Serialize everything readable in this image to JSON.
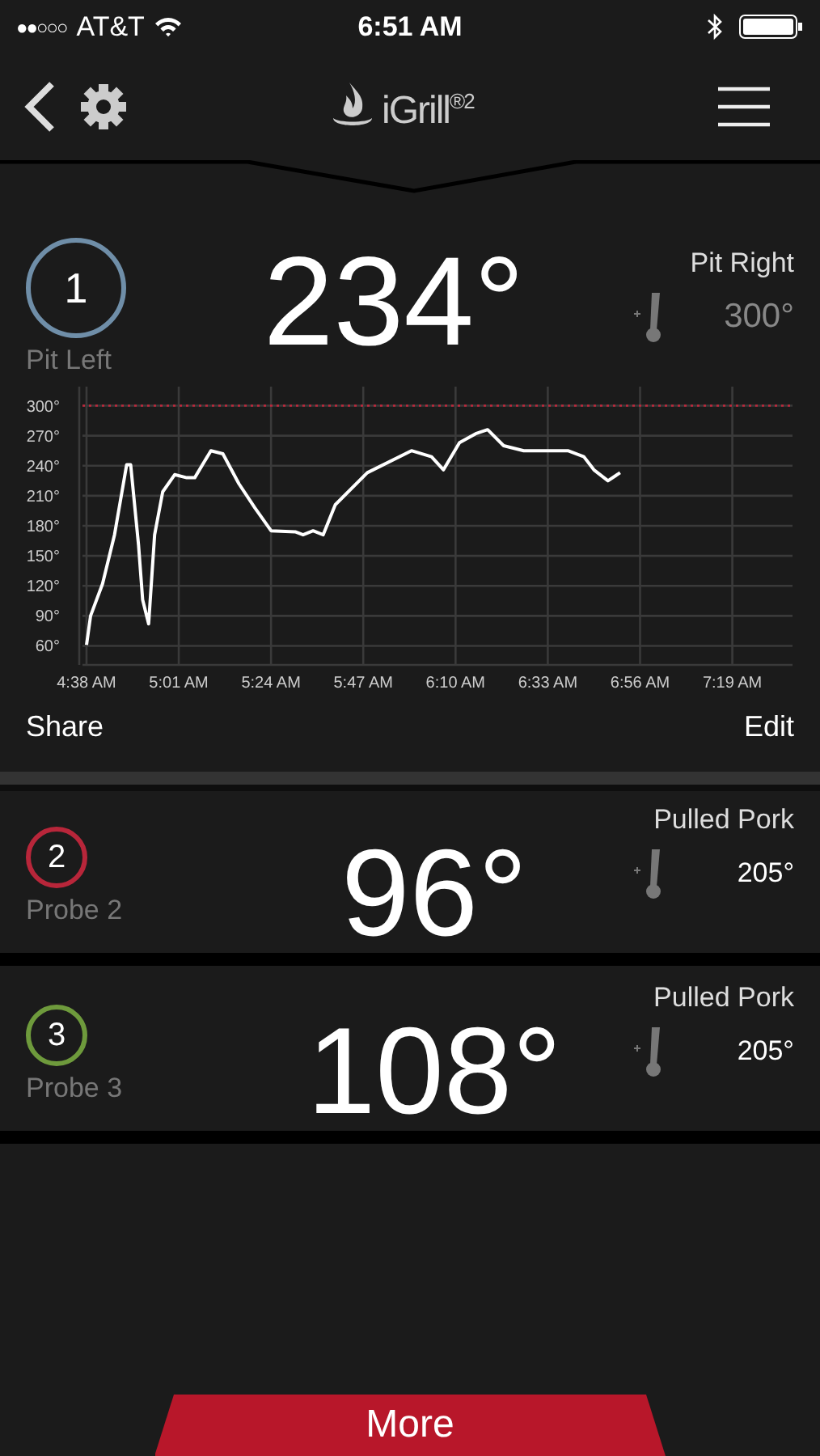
{
  "status_bar": {
    "signal": "●●○○○",
    "carrier": "AT&T",
    "time": "6:51 AM"
  },
  "header": {
    "logo": "iGrill$^{®2}$"
  },
  "main_probe": {
    "number": "1",
    "name": "Pit Left",
    "temp": "234°",
    "color": "#6f8ea8",
    "target_label": "Pit Right",
    "target": "300°",
    "chart_data": {
      "type": "line",
      "x": [
        278,
        279,
        282,
        285,
        288,
        289,
        291,
        292,
        293.5,
        295,
        297,
        300,
        303,
        305,
        309,
        312,
        316,
        320,
        324,
        330,
        332,
        334.5,
        337,
        340,
        348,
        359,
        364,
        367,
        371,
        375,
        378,
        382,
        387,
        398,
        402,
        404.5,
        408,
        411
      ],
      "series": [
        {
          "color": "#ffffff",
          "values": [
            61,
            90,
            122,
            171,
            241,
            241,
            160,
            106,
            82,
            171,
            214,
            231,
            228,
            228,
            255,
            252,
            222,
            198,
            175,
            174,
            171,
            175,
            171,
            201,
            233,
            255,
            249,
            236,
            263,
            272,
            276,
            260,
            255,
            255,
            249,
            236,
            225,
            233
          ]
        }
      ],
      "xlim": [
        277,
        454
      ],
      "ylim": [
        41,
        319
      ],
      "xticks": [
        {
          "value": 278,
          "label": "4:38 AM"
        },
        {
          "value": 301,
          "label": "5:01 AM"
        },
        {
          "value": 324,
          "label": "5:24 AM"
        },
        {
          "value": 347,
          "label": "5:47 AM"
        },
        {
          "value": 370,
          "label": "6:10 AM"
        },
        {
          "value": 393,
          "label": "6:33 AM"
        },
        {
          "value": 416,
          "label": "6:56 AM"
        },
        {
          "value": 439,
          "label": "7:19 AM"
        }
      ],
      "yticks": [
        {
          "value": 60,
          "label": "60°"
        },
        {
          "value": 90,
          "label": "90°"
        },
        {
          "value": 120,
          "label": "120°"
        },
        {
          "value": 150,
          "label": "150°"
        },
        {
          "value": 180,
          "label": "180°"
        },
        {
          "value": 210,
          "label": "210°"
        },
        {
          "value": 240,
          "label": "240°"
        },
        {
          "value": 270,
          "label": "270°"
        },
        {
          "value": 300,
          "label": "300°"
        }
      ],
      "grid": true,
      "ref_lines": [
        {
          "axis": "y",
          "value": 300,
          "color": "#c0283c"
        }
      ]
    },
    "actions": [
      "Share",
      "Edit"
    ]
  },
  "probes": [
    {
      "number": "2",
      "name": "Probe 2",
      "temp": "96°",
      "color": "#b8263a",
      "target_label": "Pulled Pork",
      "target": "205°"
    },
    {
      "number": "3",
      "name": "Probe 3",
      "temp": "108°",
      "color": "#6e9a3c",
      "target_label": "Pulled Pork",
      "target": "205°"
    }
  ],
  "more_button": "More"
}
